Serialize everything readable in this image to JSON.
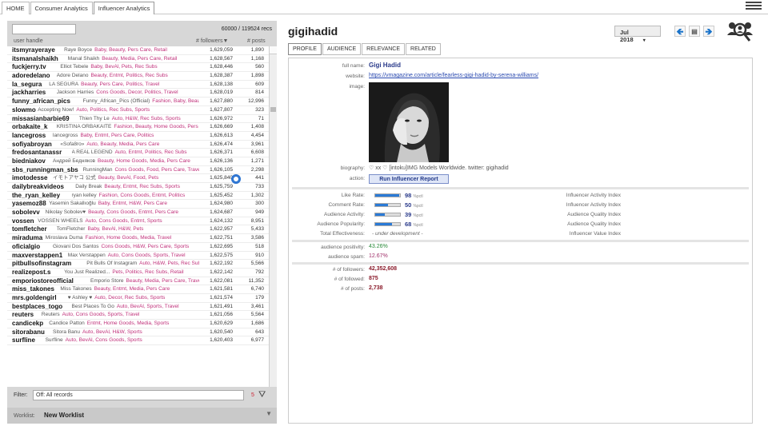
{
  "tabs": [
    "HOME",
    "Consumer Analytics",
    "Influencer Analytics"
  ],
  "list": {
    "record_count": "60000 / 119524 recs",
    "headers": {
      "handle": "user handle",
      "followers": "# followers▼",
      "posts": "# posts"
    },
    "rows": [
      {
        "handle": "itsmyrayeraye",
        "name": "Raye Boyce",
        "cats": "Baby, Beauty, Pers Care, Retail",
        "followers": "1,629,059",
        "posts": "1,890"
      },
      {
        "handle": "itsmanalshaikh",
        "name": "Manal Shaikh",
        "cats": "Beauty, Media, Pers Care, Retail",
        "followers": "1,628,567",
        "posts": "1,168"
      },
      {
        "handle": "fuckjerry.tv",
        "name": "Elliot Tebele",
        "cats": "Baby, BevAl, Pets, Rec Subs",
        "followers": "1,628,446",
        "posts": "560"
      },
      {
        "handle": "adoredelano",
        "name": "Adore Delano",
        "cats": "Beauty, Entmt, Politics, Rec Subs",
        "followers": "1,628,387",
        "posts": "1,898"
      },
      {
        "handle": "la_segura",
        "name": "LA SEGURA",
        "cats": "Beauty, Pers Care, Politics, Travel",
        "followers": "1,628,138",
        "posts": "609"
      },
      {
        "handle": "jackharries",
        "name": "Jackson Harries",
        "cats": "Cons Goods, Decor, Politics, Travel",
        "followers": "1,628,019",
        "posts": "814"
      },
      {
        "handle": "funny_african_pics",
        "name": "Funny_African_Pics (Official)",
        "cats": "Fashion, Baby, Beauty, M",
        "followers": "1,627,880",
        "posts": "12,996"
      },
      {
        "handle": "slowmo",
        "name": "Accepting Now!",
        "cats": "Auto, Politics, Rec Subs, Sports",
        "followers": "1,627,807",
        "posts": "323"
      },
      {
        "handle": "missasianbarbie69",
        "name": "Thien Thy Le",
        "cats": "Auto, H&W, Rec Subs, Sports",
        "followers": "1,626,972",
        "posts": "71"
      },
      {
        "handle": "orbakaite_k",
        "name": "KRISTINA ORBAKAITE",
        "cats": "Fashion, Beauty, Home Goods, Pers C",
        "followers": "1,626,669",
        "posts": "1,408"
      },
      {
        "handle": "lancegross",
        "name": "lancegross",
        "cats": "Baby, Entmt, Pers Care, Politics",
        "followers": "1,626,613",
        "posts": "4,454"
      },
      {
        "handle": "sofiyabroyan",
        "name": "«Sofa8ro»",
        "cats": "Auto, Beauty, Media, Pers Care",
        "followers": "1,626,474",
        "posts": "3,961"
      },
      {
        "handle": "fredosantanassr",
        "name": "A REAL LEGEND",
        "cats": "Auto, Entmt, Politics, Rec Subs",
        "followers": "1,626,371",
        "posts": "6,608"
      },
      {
        "handle": "biedniakov",
        "name": "Андрей Бедняков",
        "cats": "Beauty, Home Goods, Media, Pers Care",
        "followers": "1,626,136",
        "posts": "1,271"
      },
      {
        "handle": "sbs_runningman_sbs",
        "name": "RunningMan",
        "cats": "Cons Goods, Food, Pers Care, Travel",
        "followers": "1,626,105",
        "posts": "2,298"
      },
      {
        "handle": "imotodesse",
        "name": "イモトアヤコ 公式",
        "cats": "Beauty, BevAl, Food, Pets",
        "followers": "1,625,840",
        "posts": "441"
      },
      {
        "handle": "dailybreakvideos",
        "name": "Daily Break",
        "cats": "Beauty, Entmt, Rec Subs, Sports",
        "followers": "1,625,759",
        "posts": "733"
      },
      {
        "handle": "the_ryan_kelley",
        "name": "ryan kelley",
        "cats": "Fashion, Cons Goods, Entmt, Politics",
        "followers": "1,625,452",
        "posts": "1,302"
      },
      {
        "handle": "yasemoz88",
        "name": "Yasemin Sakallıoğlu",
        "cats": "Baby, Entmt, H&W, Pers Care",
        "followers": "1,624,980",
        "posts": "300"
      },
      {
        "handle": "sobolevv",
        "name": "Nikolay Sobolev♥",
        "cats": "Beauty, Cons Goods, Entmt, Pers Care",
        "followers": "1,624,687",
        "posts": "949"
      },
      {
        "handle": "vossen",
        "name": "VOSSEN WHEELS",
        "cats": "Auto, Cons Goods, Entmt, Sports",
        "followers": "1,624,132",
        "posts": "8,951"
      },
      {
        "handle": "tomfletcher",
        "name": "TomFletcher",
        "cats": "Baby, BevAl, H&W, Pets",
        "followers": "1,622,957",
        "posts": "5,433"
      },
      {
        "handle": "miraduma",
        "name": "Miroslava Duma",
        "cats": "Fashion, Home Goods, Media, Travel",
        "followers": "1,622,751",
        "posts": "3,586"
      },
      {
        "handle": "oficialgio",
        "name": "Giovani Dos Santos",
        "cats": "Cons Goods, H&W, Pers Care, Sports",
        "followers": "1,622,695",
        "posts": "518"
      },
      {
        "handle": "maxverstappen1",
        "name": "Max Verstappen",
        "cats": "Auto, Cons Goods, Sports, Travel",
        "followers": "1,622,575",
        "posts": "910"
      },
      {
        "handle": "pitbullsofinstagram",
        "name": "Pit Bulls Of Instagram",
        "cats": "Auto, H&W, Pets, Rec Subs",
        "followers": "1,622,192",
        "posts": "5,566"
      },
      {
        "handle": "realizepost.s",
        "name": "You Just Realized...",
        "cats": "Pets, Politics, Rec Subs, Retail",
        "followers": "1,622,142",
        "posts": "792"
      },
      {
        "handle": "emporiostoreofficial",
        "name": "Emporio Store",
        "cats": "Beauty, Media, Pers Care, Travel",
        "followers": "1,622,081",
        "posts": "11,352"
      },
      {
        "handle": "miss_takones",
        "name": "Miss Takones",
        "cats": "Beauty, Entmt, Media, Pers Care",
        "followers": "1,621,581",
        "posts": "6,740"
      },
      {
        "handle": "mrs.goldengirl",
        "name": "♥ Ashley ♥",
        "cats": "Auto, Decor, Rec Subs, Sports",
        "followers": "1,621,574",
        "posts": "179"
      },
      {
        "handle": "bestplaces_togo",
        "name": "Best Places To Go",
        "cats": "Auto, BevAl, Sports, Travel",
        "followers": "1,621,491",
        "posts": "3,461"
      },
      {
        "handle": "reuters",
        "name": "Reuters",
        "cats": "Auto, Cons Goods, Sports, Travel",
        "followers": "1,621,056",
        "posts": "5,564"
      },
      {
        "handle": "candicekp",
        "name": "Candice Patton",
        "cats": "Entmt, Home Goods, Media, Sports",
        "followers": "1,620,629",
        "posts": "1,686"
      },
      {
        "handle": "sitorabanu",
        "name": "Sitora Banu",
        "cats": "Auto, BevAl, H&W, Sports",
        "followers": "1,620,540",
        "posts": "643"
      },
      {
        "handle": "surfline",
        "name": "Surfline",
        "cats": "Auto, BevAl, Cons Goods, Sports",
        "followers": "1,620,403",
        "posts": "6,977"
      }
    ]
  },
  "filter": {
    "label": "Filter:",
    "value": "Off: All records",
    "count": "5"
  },
  "worklist": {
    "label": "Worklist:",
    "value": "New Worklist"
  },
  "profile": {
    "title": "gigihadid",
    "month": "Jul 2018",
    "tabs": [
      "PROFILE",
      "AUDIENCE",
      "RELEVANCE",
      "RELATED"
    ],
    "fields": {
      "full_name_label": "full name:",
      "full_name": "Gigi Hadid",
      "website_label": "website:",
      "website": "https://vmagazine.com/article/fearless-gigi-hadid-by-serena-williams/",
      "image_label": "image:",
      "biography_label": "biography:",
      "biography": "♡ xx ♡ [intoku]IMG Models Worldwide. twitter: gigihadid",
      "action_label": "action:",
      "action_button": "Run Influencer Report"
    },
    "metrics": [
      {
        "label": "Like Rate:",
        "value": "98",
        "pct": 0.98,
        "right": "Influencer Activity Index"
      },
      {
        "label": "Comment Rate:",
        "value": "50",
        "pct": 0.5,
        "right": "Influencer Activity Index"
      },
      {
        "label": "Audience Activity:",
        "value": "39",
        "pct": 0.39,
        "right": "Audience Quality Index"
      },
      {
        "label": "Audience Popularity:",
        "value": "68",
        "pct": 0.68,
        "right": "Audience Quality Index"
      }
    ],
    "pctl": "%pctl",
    "total_label": "Total Effectiveness:",
    "total_value": "- under development -",
    "total_right": "Influencer Value Index",
    "positivity_label": "audience positivity:",
    "positivity": "43.26%",
    "spam_label": "audience spam:",
    "spam": "12.67%",
    "followers_label": "# of followers:",
    "followers": "42,352,608",
    "followed_label": "# of followed:",
    "followed": "875",
    "posts_label": "# of posts:",
    "posts": "2,738"
  },
  "colors": {
    "accent": "#2a7ad6",
    "category": "#c0307a",
    "dark_blue": "#2a3a8a"
  }
}
